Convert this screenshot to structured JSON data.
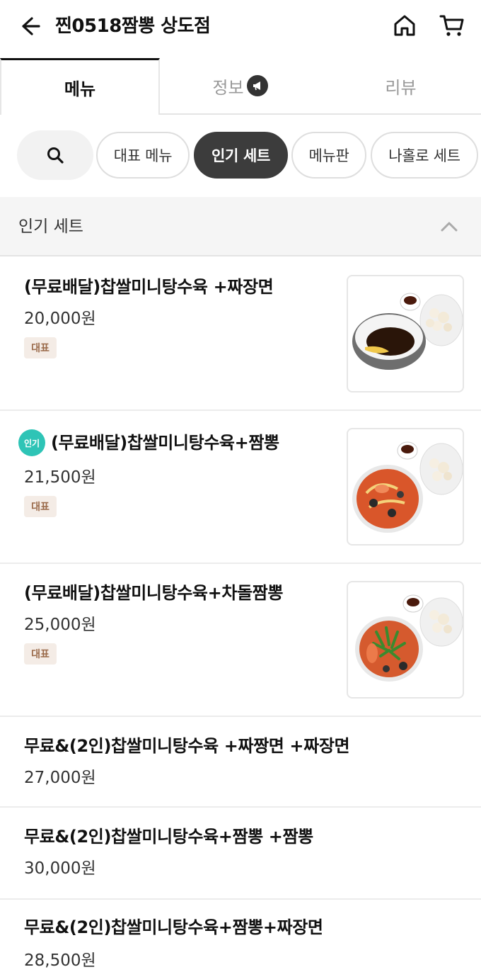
{
  "header": {
    "store_name": "찐0518짬뽕 상도점",
    "back_icon": "back-arrow-icon",
    "home_icon": "home-icon",
    "cart_icon": "cart-icon"
  },
  "tabs": [
    {
      "label": "메뉴",
      "active": true
    },
    {
      "label": "정보",
      "active": false,
      "badge_icon": "megaphone-icon"
    },
    {
      "label": "리뷰",
      "active": false
    }
  ],
  "chips": [
    {
      "label": "대표 메뉴",
      "active": false
    },
    {
      "label": "인기 세트",
      "active": true
    },
    {
      "label": "메뉴판",
      "active": false
    },
    {
      "label": "나홀로 세트",
      "active": false
    }
  ],
  "section": {
    "title": "인기 세트",
    "collapse_icon": "chevron-up-icon"
  },
  "items": [
    {
      "name": "(무료배달)찹쌀미니탕수육 +짜장면",
      "price": "20,000원",
      "tag": "대표"
    },
    {
      "name": "(무료배달)찹쌀미니탕수육+짬뽕",
      "price": "21,500원",
      "tag": "대표",
      "badge": "인기"
    },
    {
      "name": "(무료배달)찹쌀미니탕수육+차돌짬뽕",
      "price": "25,000원",
      "tag": "대표"
    },
    {
      "name": "무료&(2인)찹쌀미니탕수육 +짜짱면 +짜장면",
      "price": "27,000원"
    },
    {
      "name": "무료&(2인)찹쌀미니탕수육+짬뽕 +짬뽕",
      "price": "30,000원"
    },
    {
      "name": "무료&(2인)찹쌀미니탕수육+짬뽕+짜장면",
      "price": "28,500원"
    }
  ],
  "colors": {
    "accent_dark": "#3c3c3c",
    "popular_badge": "#2ec4b6",
    "tag_bg": "#f4ece6",
    "tag_text": "#9a6a4a"
  }
}
